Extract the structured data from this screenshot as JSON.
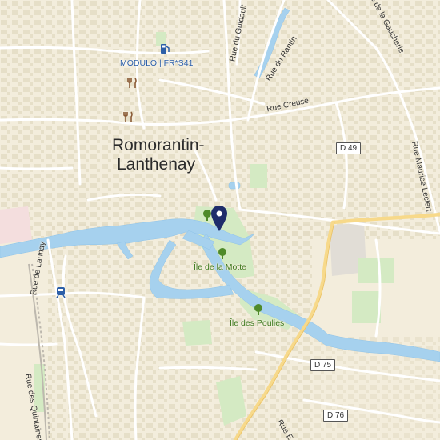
{
  "map": {
    "town_name_line1": "Romorantin-",
    "town_name_line2": "Lanthenay",
    "colors": {
      "land": "#f3eddc",
      "water": "#a6d1ee",
      "road": "#ffffff",
      "main_road": "#f7d98a",
      "park": "#d4eac3",
      "building": "#e6dfca",
      "marker": "#1f2d6b",
      "poi_blue": "#2c5fa8",
      "park_text": "#3d7a1e",
      "restaurant_brown": "#8a5a35"
    },
    "streets": {
      "rue_du_guidault": "Rue du Guidault",
      "rue_du_rantin": "Rue du Rantin",
      "rue_gaucherie": "Rue de la Gaucherie",
      "rue_creuse": "Rue Creuse",
      "rue_maurice_leclert": "Rue Maurice Leclert",
      "rue_de_launay": "Rue de Launay",
      "rue_des_quintaines": "Rue des Quintaines",
      "rue_e": "Rue E"
    },
    "roads": {
      "d49": "D 49",
      "d75": "D 75",
      "d76": "D 76"
    },
    "parks": {
      "ile_motte": "Île de la Motte",
      "ile_poulies": "Île des Poulies"
    },
    "poi": {
      "fuel_label": "MODULO | FR*S41"
    },
    "icons": [
      "fuel-icon",
      "restaurant-icon",
      "train-icon",
      "tree-icon",
      "location-pin-icon"
    ]
  }
}
